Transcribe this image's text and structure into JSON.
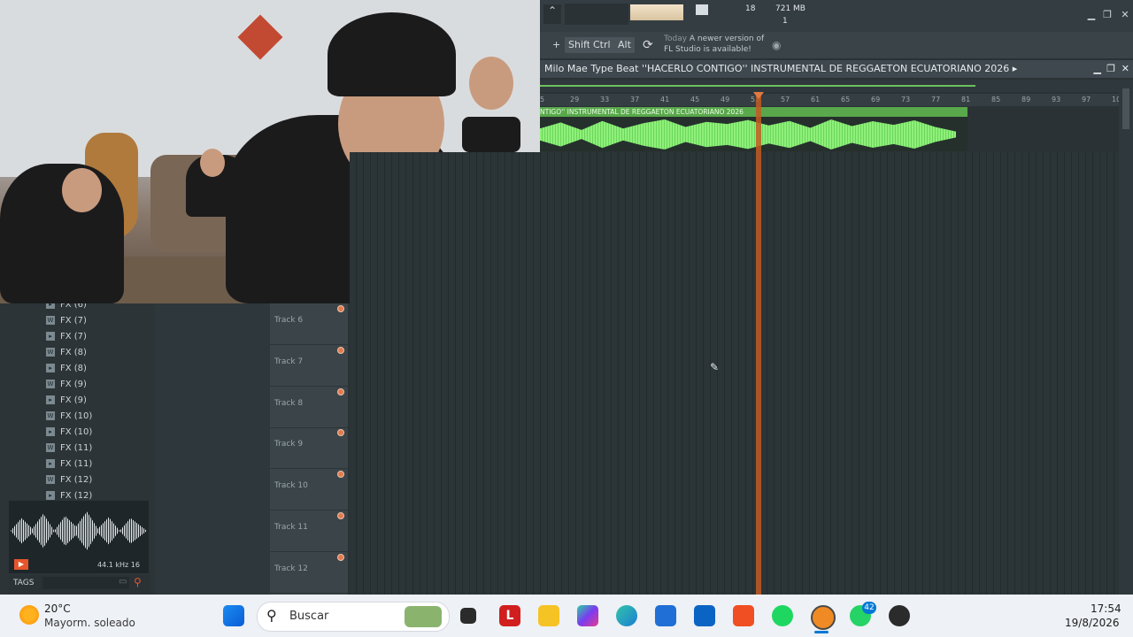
{
  "fl": {
    "hint_title": "Today",
    "hint_text": "A newer version of FL Studio is available!",
    "cpu": "18",
    "mem": "721 MB",
    "voices": "1",
    "keys": {
      "shift": "Shift",
      "ctrl": "Ctrl",
      "alt": "Alt"
    },
    "playlist_title": "Milo Mae Type Beat ''HACERLO CONTIGO'' INSTRUMENTAL DE REGGAETON ECUATORIANO 2026 ▸",
    "clip_label": "NTIGO'' INSTRUMENTAL DE REGGAETON ECUATORIANO 2026",
    "ruler": [
      "5",
      "29",
      "33",
      "37",
      "41",
      "45",
      "49",
      "53",
      "57",
      "61",
      "65",
      "69",
      "73",
      "77",
      "81",
      "85",
      "89",
      "93",
      "97",
      "10"
    ],
    "tracks": [
      "Track 6",
      "Track 7",
      "Track 8",
      "Track 9",
      "Track 10",
      "Track 11",
      "Track 12"
    ],
    "browser_items": [
      {
        "icon": "fx-folder-icon",
        "label": "FX (6)"
      },
      {
        "icon": "wav-icon",
        "label": "FX (7)"
      },
      {
        "icon": "fx-folder-icon",
        "label": "FX (7)"
      },
      {
        "icon": "wav-icon",
        "label": "FX (8)"
      },
      {
        "icon": "fx-folder-icon",
        "label": "FX (8)"
      },
      {
        "icon": "wav-icon",
        "label": "FX (9)"
      },
      {
        "icon": "fx-folder-icon",
        "label": "FX (9)"
      },
      {
        "icon": "wav-icon",
        "label": "FX (10)"
      },
      {
        "icon": "fx-folder-icon",
        "label": "FX (10)"
      },
      {
        "icon": "wav-icon",
        "label": "FX (11)"
      },
      {
        "icon": "fx-folder-icon",
        "label": "FX (11)"
      },
      {
        "icon": "wav-icon",
        "label": "FX (12)"
      },
      {
        "icon": "fx-folder-icon",
        "label": "FX (12)"
      }
    ],
    "sample_info": "44.1 kHz 16",
    "tags_label": "TAGS"
  },
  "taskbar": {
    "weather_temp": "20°C",
    "weather_desc": "Mayorm. soleado",
    "search_placeholder": "Buscar",
    "time": "17:54",
    "date": "19/8/2026",
    "whatsapp_badge": "42",
    "colors": {
      "accent": "#0078d4",
      "fl_orange": "#c25c22",
      "wave_green": "#8ff07a"
    }
  }
}
